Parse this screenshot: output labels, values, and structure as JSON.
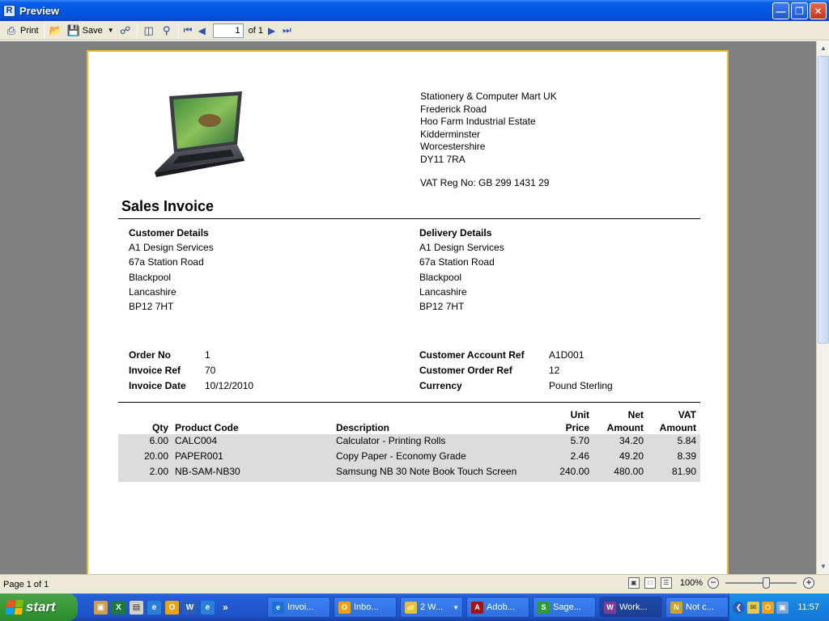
{
  "window": {
    "title": "Preview",
    "app_icon": "report-app-icon",
    "controls": [
      "minimize-icon",
      "restore-icon",
      "close-icon"
    ]
  },
  "toolbar": {
    "print_label": "Print",
    "save_label": "Save",
    "page_value": "1",
    "page_of": "of 1"
  },
  "company": {
    "name": "Stationery & Computer Mart UK",
    "address": [
      "Frederick Road",
      "Hoo Farm Industrial Estate",
      "Kidderminster",
      "Worcestershire",
      "DY11 7RA"
    ],
    "vat": "VAT Reg No: GB 299 1431 29"
  },
  "invoice": {
    "title": "Sales Invoice",
    "customer": {
      "heading": "Customer Details",
      "lines": [
        "A1 Design Services",
        "67a Station Road",
        "Blackpool",
        "Lancashire",
        "BP12 7HT"
      ]
    },
    "delivery": {
      "heading": "Delivery Details",
      "lines": [
        "A1 Design Services",
        "67a Station Road",
        "Blackpool",
        "Lancashire",
        "BP12 7HT"
      ]
    },
    "order_no": {
      "label": "Order No",
      "value": "1"
    },
    "invoice_ref": {
      "label": "Invoice Ref",
      "value": "70"
    },
    "invoice_date": {
      "label": "Invoice Date",
      "value": "10/12/2010"
    },
    "account_ref": {
      "label": "Customer Account Ref",
      "value": "A1D001"
    },
    "order_ref": {
      "label": "Customer Order Ref",
      "value": "12"
    },
    "currency": {
      "label": "Currency",
      "value": "Pound Sterling"
    }
  },
  "items": {
    "headers": {
      "qty": "Qty",
      "code": "Product Code",
      "desc": "Description",
      "unit_1": "Unit",
      "unit_2": "Price",
      "net_1": "Net",
      "net_2": "Amount",
      "vat_1": "VAT",
      "vat_2": "Amount"
    },
    "rows": [
      {
        "qty": "6.00",
        "code": "CALC004",
        "desc": "Calculator - Printing Rolls",
        "unit": "5.70",
        "net": "34.20",
        "vat": "5.84"
      },
      {
        "qty": "20.00",
        "code": "PAPER001",
        "desc": "Copy Paper - Economy Grade",
        "unit": "2.46",
        "net": "49.20",
        "vat": "8.39"
      },
      {
        "qty": "2.00",
        "code": "NB-SAM-NB30",
        "desc": "Samsung NB 30 Note Book Touch Screen",
        "unit": "240.00",
        "net": "480.00",
        "vat": "81.90"
      }
    ]
  },
  "status": {
    "page": "Page 1 of 1",
    "zoom": "100%"
  },
  "taskbar": {
    "start": "start",
    "tasks": [
      {
        "label": "Invoi...",
        "color": "#1b6fd6"
      },
      {
        "label": "Inbo...",
        "color": "#e8a317"
      },
      {
        "label": "2 W...",
        "color": "#e2c04a"
      },
      {
        "label": "Adob...",
        "color": "#a01515"
      },
      {
        "label": "Sage...",
        "color": "#2f9a3a"
      },
      {
        "label": "Work...",
        "color": "#7a3d9c"
      },
      {
        "label": "Not c...",
        "color": "#c9a23a"
      }
    ],
    "clock": "11:57"
  }
}
